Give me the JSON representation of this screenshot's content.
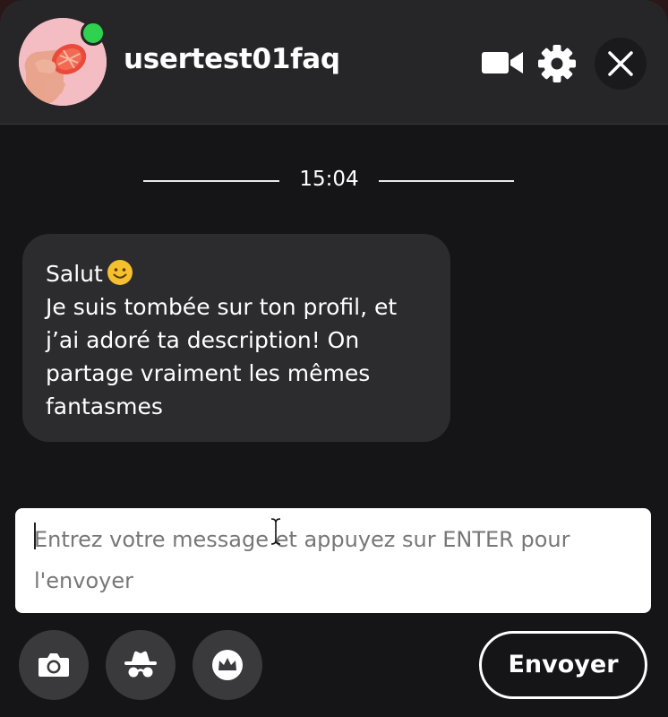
{
  "header": {
    "username": "usertest01faq",
    "online": true,
    "icons": {
      "video": "video-camera-icon",
      "settings": "gear-icon",
      "close": "close-icon"
    }
  },
  "conversation": {
    "time_separator": "15:04",
    "messages": [
      {
        "lines": [
          "Salut",
          "Je suis tombée sur ton profil, et",
          "j’ai adoré ta description! On",
          "partage vraiment les mêmes",
          "fantasmes"
        ],
        "emoji": "smiling-face-icon"
      }
    ]
  },
  "composer": {
    "placeholder": "Entrez votre message et appuyez sur ENTER pour l'envoyer",
    "value": ""
  },
  "actions": [
    {
      "icon": "camera-icon"
    },
    {
      "icon": "incognito-icon"
    },
    {
      "icon": "crown-icon"
    }
  ],
  "send_label": "Envoyer",
  "colors": {
    "background": "#151416",
    "header": "#262527",
    "bubble": "#2c2b2d",
    "online": "#2ed24f",
    "emoji": "#f5c02e"
  }
}
